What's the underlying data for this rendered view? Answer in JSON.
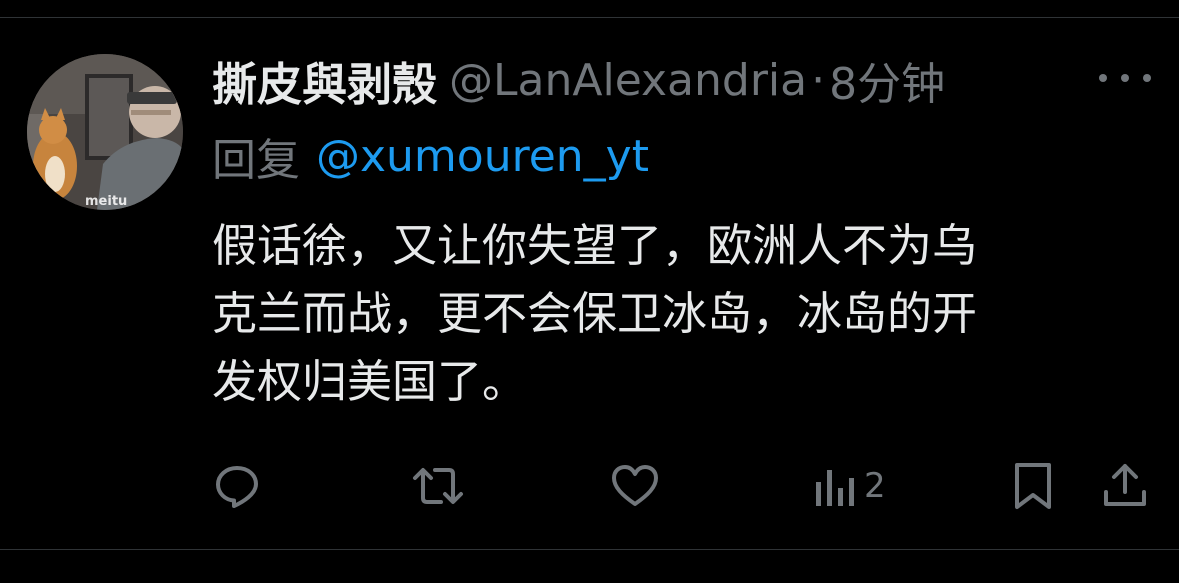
{
  "tweet": {
    "display_name": "撕皮與剥殼",
    "handle": "@LanAlexandria",
    "separator": "·",
    "time": "8分钟",
    "reply_label": "回复",
    "reply_to": "@xumouren_yt",
    "body_lines": [
      "假话徐，又让你失望了，欧洲人不为乌",
      "克兰而战，更不会保卫冰岛，冰岛的开",
      "发权归美国了。"
    ],
    "avatar_watermark": "meitu"
  },
  "actions": {
    "reply_icon": "reply-icon",
    "retweet_icon": "retweet-icon",
    "like_icon": "like-icon",
    "views_icon": "views-icon",
    "views_count": "2",
    "bookmark_icon": "bookmark-icon",
    "share_icon": "share-icon"
  },
  "colors": {
    "background": "#000000",
    "primary_text": "#e7e9ea",
    "secondary_text": "#71767b",
    "link": "#1d9bf0",
    "divider": "#2f3336"
  }
}
